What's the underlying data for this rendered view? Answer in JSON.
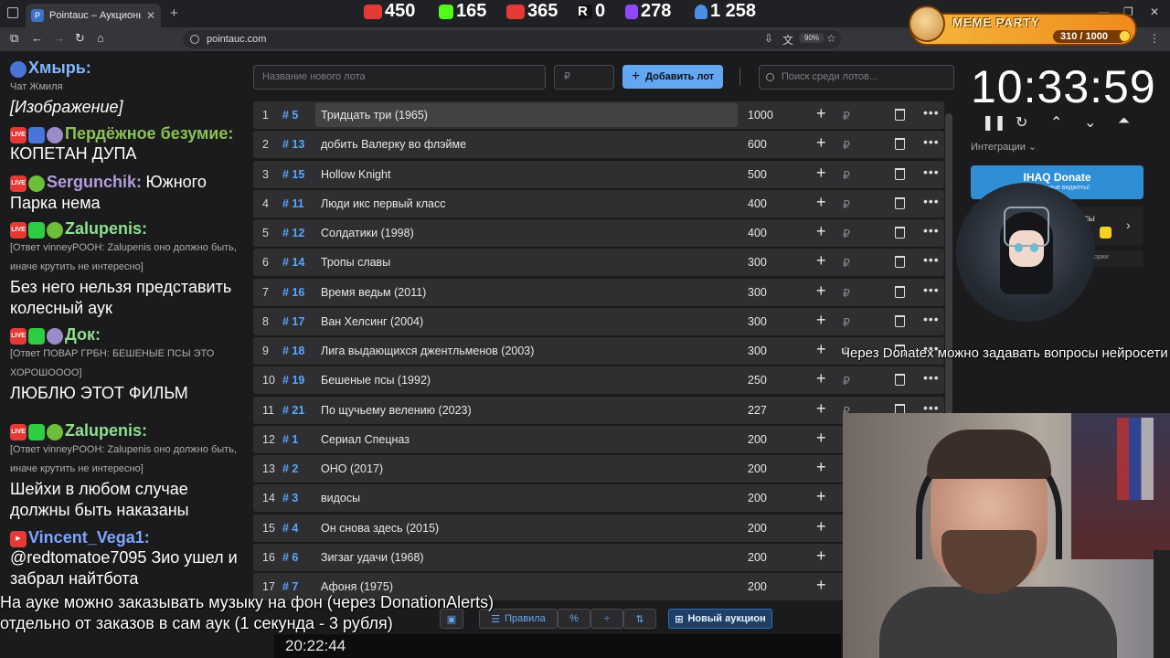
{
  "browser": {
    "tab_title": "Pointauc – Аукционы, лотереи",
    "url": "pointauc.com",
    "zoom": "90%"
  },
  "meme_party": {
    "title": "MEME PARTY",
    "count": "310 / 1000"
  },
  "chat": [
    {
      "nick": "Хмырь:",
      "nick_color": "#7fb8ff",
      "reply": "Чат Жмиля",
      "text": "[Изображение]"
    },
    {
      "nick": "Пердёжное безумие:",
      "nick_color": "#8cc152",
      "reply": "",
      "text": "КОПЕТАН ДУПА"
    },
    {
      "nick": "Sergunchik:",
      "nick_color": "#b39ddb",
      "reply": "",
      "text": "Южного Парка нема"
    },
    {
      "nick": "Zalupenis:",
      "nick_color": "#8ee08e",
      "reply": "[Ответ vinneyPOOH: Zalupenis оно должно быть, иначе крутить не интересно]",
      "text": "Без него нельзя представить колесный аук"
    },
    {
      "nick": "Док:",
      "nick_color": "#8ee08e",
      "reply": "[Ответ ПОВАР ГРБН: БЕШЕНЫЕ ПСЫ ЭТО ХОРОШОООО]",
      "text": "ЛЮБЛЮ ЭТОТ ФИЛЬМ"
    },
    {
      "nick": "Zalupenis:",
      "nick_color": "#8ee08e",
      "reply": "[Ответ vinneyPOOH: Zalupenis оно должно быть, иначе крутить не интересно]",
      "text": "Шейхи в любом случае должны быть наказаны"
    },
    {
      "nick": "Vincent_Vega1:",
      "nick_color": "#7aa7ff",
      "reply": "",
      "text": "@redtomatoe7095 Зио ушел и забрал найтбота"
    }
  ],
  "form": {
    "lot_placeholder": "Название нового лота",
    "rub_placeholder": "₽",
    "add_label": "Добавить лот",
    "search_placeholder": "Поиск среди лотов..."
  },
  "lots": [
    {
      "idx": "1",
      "num": "# 5",
      "name": "Тридцать три (1965)",
      "amount": "1000"
    },
    {
      "idx": "2",
      "num": "# 13",
      "name": "добить Валерку во флэйме",
      "amount": "600"
    },
    {
      "idx": "3",
      "num": "# 15",
      "name": "Hollow Knight",
      "amount": "500"
    },
    {
      "idx": "4",
      "num": "# 11",
      "name": "Люди икс первый класс",
      "amount": "400"
    },
    {
      "idx": "5",
      "num": "# 12",
      "name": "Солдатики (1998)",
      "amount": "400"
    },
    {
      "idx": "6",
      "num": "# 14",
      "name": "Тропы славы",
      "amount": "300"
    },
    {
      "idx": "7",
      "num": "# 16",
      "name": "Время ведьм (2011)",
      "amount": "300"
    },
    {
      "idx": "8",
      "num": "# 17",
      "name": "Ван Хелсинг (2004)",
      "amount": "300"
    },
    {
      "idx": "9",
      "num": "# 18",
      "name": "Лига выдающихся джентльменов (2003)",
      "amount": "300"
    },
    {
      "idx": "10",
      "num": "# 19",
      "name": "Бешеные псы (1992)",
      "amount": "250"
    },
    {
      "idx": "11",
      "num": "# 21",
      "name": "По щучьему велению (2023)",
      "amount": "227"
    },
    {
      "idx": "12",
      "num": "# 1",
      "name": "Сериал Спецназ",
      "amount": "200"
    },
    {
      "idx": "13",
      "num": "# 2",
      "name": "ОНО (2017)",
      "amount": "200"
    },
    {
      "idx": "14",
      "num": "# 3",
      "name": "видосы",
      "amount": "200"
    },
    {
      "idx": "15",
      "num": "# 4",
      "name": "Он снова здесь (2015)",
      "amount": "200"
    },
    {
      "idx": "16",
      "num": "# 6",
      "name": "Зигзаг удачи (1968)",
      "amount": "200"
    },
    {
      "idx": "17",
      "num": "# 7",
      "name": "Афоня (1975)",
      "amount": "200"
    }
  ],
  "timer": {
    "value": "10:33:59",
    "integrations_label": "Интеграции",
    "donate_label": "IHAQ Donate",
    "donate_sub": "уникальные виджеты!",
    "panel2_label": "исы",
    "panel3_label": "ории"
  },
  "overlay": {
    "right_notice": "Через Donatex можно задавать вопросы нейросети",
    "left_notice_1": "На ауке можно заказывать музыку на фон (через DonationAlerts)",
    "left_notice_2": "отдельно от заказов в сам аук (1 секунда - 3 рубля)"
  },
  "bottom": {
    "rules_label": "Правила",
    "percent_label": "%",
    "new_auction_label": "Новый аукцион"
  },
  "stats": {
    "clock": "20:22:44",
    "youtube": "450",
    "kick": "165",
    "vk": "365",
    "rumble": "0",
    "twitch": "278",
    "viewers": "1 258"
  },
  "colors": {
    "accent": "#63a7f2",
    "lot_number": "#58a6ff",
    "background": "#1b1b1d"
  }
}
